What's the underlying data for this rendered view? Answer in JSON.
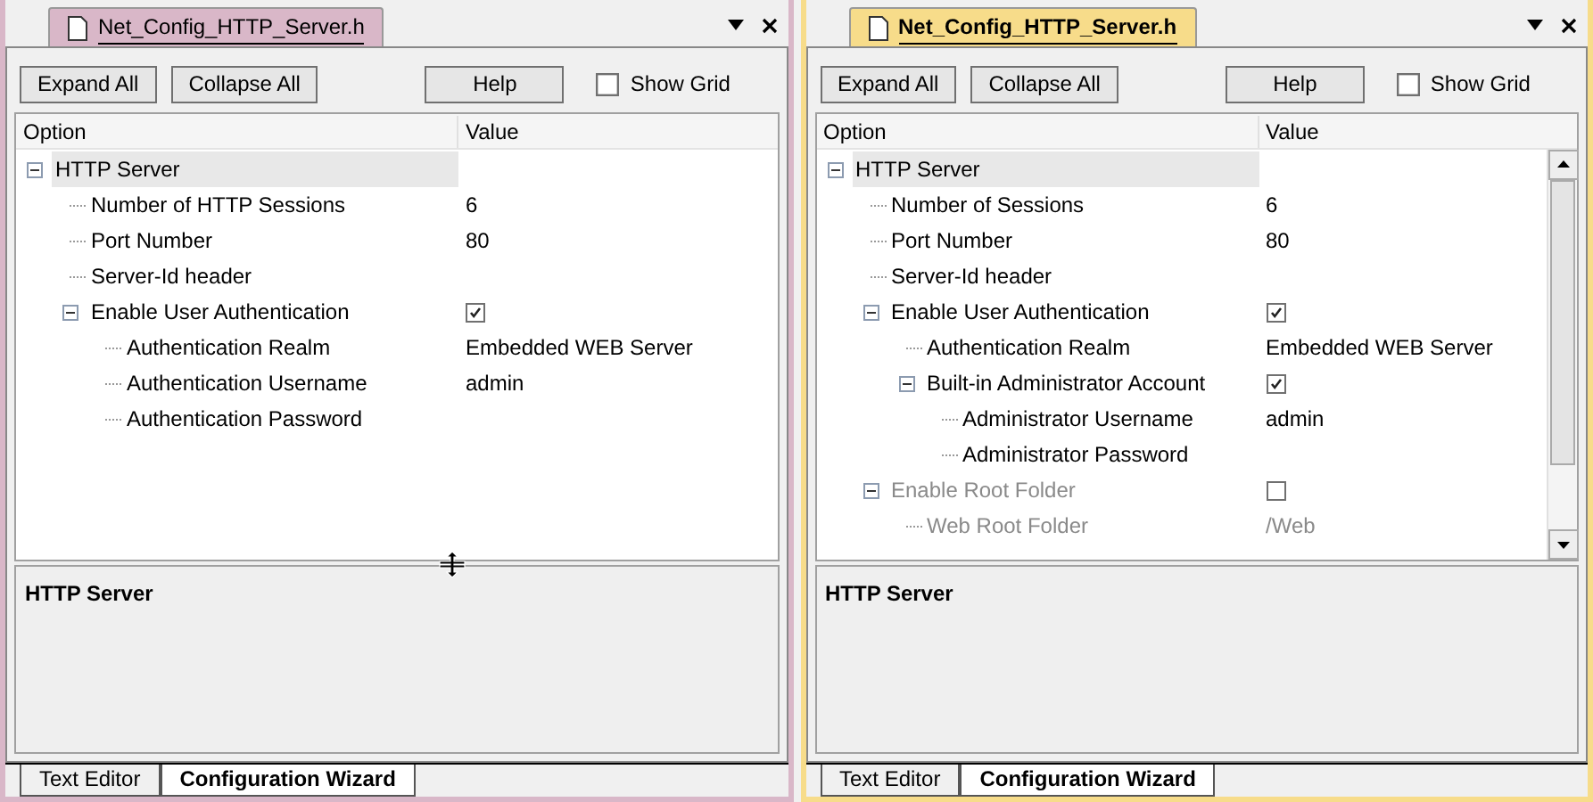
{
  "panels": [
    {
      "file_tab": {
        "label": "Net_Config_HTTP_Server.h",
        "selected": false
      },
      "toolbar": {
        "buttons": [
          "Expand All",
          "Collapse All"
        ],
        "help": "Help",
        "show_grid": {
          "label": "Show Grid",
          "checked": false
        }
      },
      "columns": [
        "Option",
        "Value"
      ],
      "scrollbar": false,
      "cursor_over_splitter": true,
      "tree": [
        {
          "label": "HTTP Server",
          "expanded": true,
          "selected": true,
          "disabled": false,
          "children": [
            {
              "label": "Number of HTTP Sessions",
              "kind": "text",
              "value": "6",
              "selected": false,
              "disabled": false
            },
            {
              "label": "Port Number",
              "kind": "text",
              "value": "80",
              "selected": false,
              "disabled": false
            },
            {
              "label": "Server-Id header",
              "kind": "text",
              "selected": false,
              "disabled": false
            },
            {
              "label": "Enable User Authentication",
              "kind": "checkbox",
              "checked": true,
              "expanded": true,
              "selected": false,
              "disabled": false,
              "children": [
                {
                  "label": "Authentication Realm",
                  "kind": "text",
                  "value": "Embedded WEB Server",
                  "selected": false,
                  "disabled": false
                },
                {
                  "label": "Authentication Username",
                  "kind": "text",
                  "value": "admin",
                  "selected": false,
                  "disabled": false
                },
                {
                  "label": "Authentication Password",
                  "kind": "text",
                  "selected": false,
                  "disabled": false
                }
              ]
            }
          ]
        }
      ],
      "description": "HTTP Server",
      "bottom_tabs": [
        {
          "label": "Text Editor",
          "selected": false
        },
        {
          "label": "Configuration Wizard",
          "selected": true
        }
      ]
    },
    {
      "file_tab": {
        "label": "Net_Config_HTTP_Server.h",
        "selected": true
      },
      "toolbar": {
        "buttons": [
          "Expand All",
          "Collapse All"
        ],
        "help": "Help",
        "show_grid": {
          "label": "Show Grid",
          "checked": false
        }
      },
      "columns": [
        "Option",
        "Value"
      ],
      "scrollbar": true,
      "cursor_over_splitter": false,
      "tree": [
        {
          "label": "HTTP Server",
          "expanded": true,
          "selected": true,
          "disabled": false,
          "children": [
            {
              "label": "Number of Sessions",
              "kind": "text",
              "value": "6",
              "selected": false,
              "disabled": false
            },
            {
              "label": "Port Number",
              "kind": "text",
              "value": "80",
              "selected": false,
              "disabled": false
            },
            {
              "label": "Server-Id header",
              "kind": "text",
              "selected": false,
              "disabled": false
            },
            {
              "label": "Enable User Authentication",
              "kind": "checkbox",
              "checked": true,
              "expanded": true,
              "selected": false,
              "disabled": false,
              "children": [
                {
                  "label": "Authentication Realm",
                  "kind": "text",
                  "value": "Embedded WEB Server",
                  "selected": false,
                  "disabled": false
                },
                {
                  "label": "Built-in Administrator Account",
                  "kind": "checkbox",
                  "checked": true,
                  "expanded": true,
                  "selected": false,
                  "disabled": false,
                  "children": [
                    {
                      "label": "Administrator Username",
                      "kind": "text",
                      "value": "admin",
                      "selected": false,
                      "disabled": false
                    },
                    {
                      "label": "Administrator Password",
                      "kind": "text",
                      "selected": false,
                      "disabled": false
                    }
                  ]
                }
              ]
            },
            {
              "label": "Enable Root Folder",
              "kind": "checkbox",
              "checked": false,
              "expanded": true,
              "selected": false,
              "disabled": true,
              "children": [
                {
                  "label": "Web Root Folder",
                  "kind": "text",
                  "value": "/Web",
                  "selected": false,
                  "disabled": true
                }
              ]
            }
          ]
        }
      ],
      "description": "HTTP Server",
      "bottom_tabs": [
        {
          "label": "Text Editor",
          "selected": false
        },
        {
          "label": "Configuration Wizard",
          "selected": true
        }
      ]
    }
  ]
}
